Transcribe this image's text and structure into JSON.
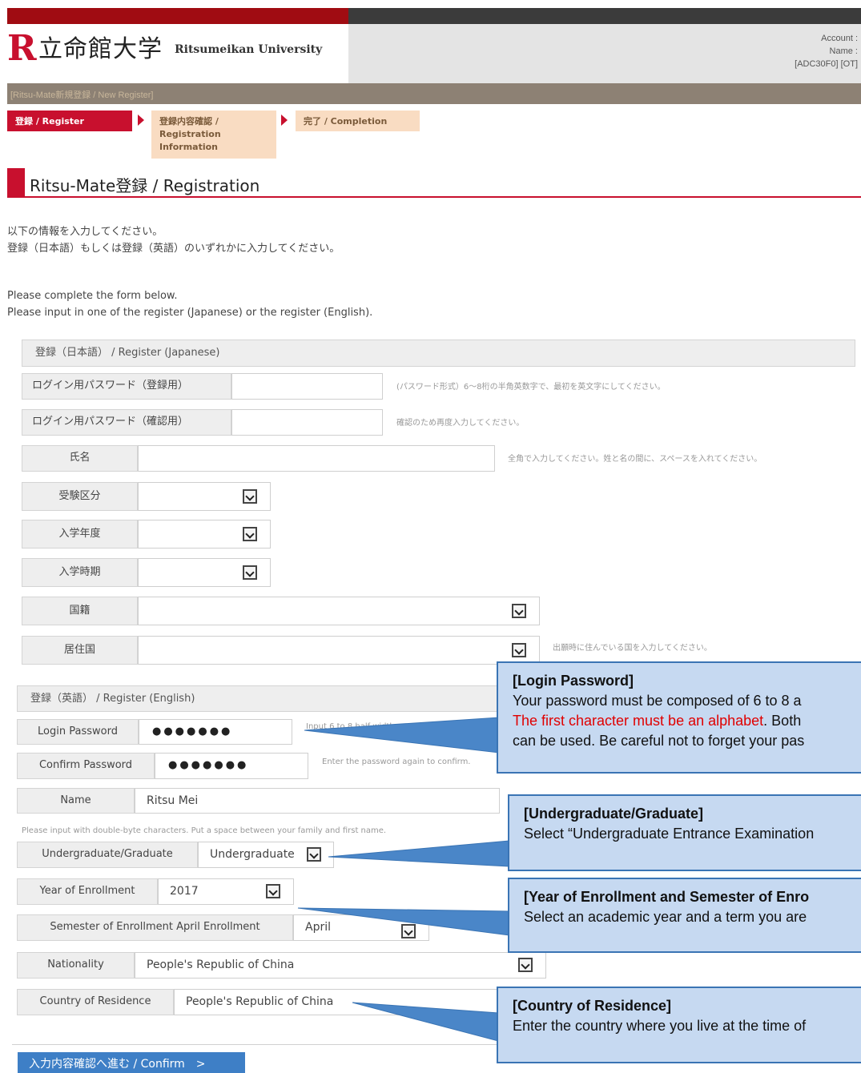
{
  "header": {
    "logo_letter": "R",
    "logo_kanji": "立命館大学",
    "logo_en": "Ritsumeikan University",
    "account_label": "Account :",
    "name_label": "Name :",
    "user_code": "[ADC30F0] [OT]"
  },
  "breadcrumb": "[Ritsu-Mate新規登録 / New Register]",
  "steps": [
    {
      "label": "登録 / Register"
    },
    {
      "label": "登録内容確認 / Registration Information"
    },
    {
      "label": "完了 / Completion"
    }
  ],
  "page_title": "Ritsu-Mate登録 / Registration",
  "intro_jp": [
    "以下の情報を入力してください。",
    "登録（日本語）もしくは登録（英語）のいずれかに入力してください。"
  ],
  "intro_en": [
    "Please complete the form below.",
    "Please input in one of the register (Japanese) or the register (English)."
  ],
  "jp_form": {
    "header": "登録（日本語） / Register (Japanese)",
    "password_label": "ログイン用パスワード（登録用）",
    "password_note": "(パスワード形式）6～8桁の半角英数字で、最初を英文字にしてください。",
    "confirm_label": "ログイン用パスワード（確認用）",
    "confirm_note": "確認のため再度入力してください。",
    "name_label": "氏名",
    "name_note": "全角で入力してください。姓と名の間に、スペースを入れてください。",
    "exam_label": "受験区分",
    "year_label": "入学年度",
    "semester_label": "入学時期",
    "nationality_label": "国籍",
    "residence_label": "居住国",
    "residence_note": "出願時に住んでいる国を入力してください。"
  },
  "en_form": {
    "header": "登録（英語） / Register (English)",
    "password_label": "Login Password",
    "password_value": "●●●●●●●",
    "password_note": "Input 6 to 8 half-width",
    "confirm_label": "Confirm Password",
    "confirm_value": "●●●●●●●",
    "confirm_note": "Enter the password again to confirm.",
    "name_label": "Name",
    "name_value": "Ritsu Mei",
    "name_note": "Please input with double-byte characters. Put a space between your family and first name.",
    "ug_label": "Undergraduate/Graduate",
    "ug_value": "Undergraduate",
    "year_label": "Year of Enrollment",
    "year_value": "2017",
    "semester_label": "Semester of Enrollment April Enrollment",
    "semester_value": "April",
    "nationality_label": "Nationality",
    "nationality_value": "People's Republic of China",
    "residence_label": "Country of Residence",
    "residence_value": "People's Republic of China"
  },
  "callouts": {
    "password_title": "[Login Password]",
    "password_line1": "Your password must be composed of 6 to 8 a",
    "password_line2_red": "The first character must be an alphabet",
    "password_line2_rest": ". Both",
    "password_line3": "can be used. Be careful not to forget your pas",
    "ug_title": "[Undergraduate/Graduate]",
    "ug_line1": "Select “Undergraduate Entrance Examination",
    "year_title": "[Year of Enrollment and Semester of Enro",
    "year_line1": "Select an academic year and a term you are",
    "residence_title": "[Country of Residence]",
    "residence_line1": "Enter the country where you live at the time of"
  },
  "confirm_button": "入力内容確認へ進む / Confirm　>",
  "colors": {
    "brand_red": "#c8102e",
    "callout_fill": "#c6d9f1",
    "callout_border": "#3a74b4",
    "button_blue": "#3e7fc6"
  }
}
